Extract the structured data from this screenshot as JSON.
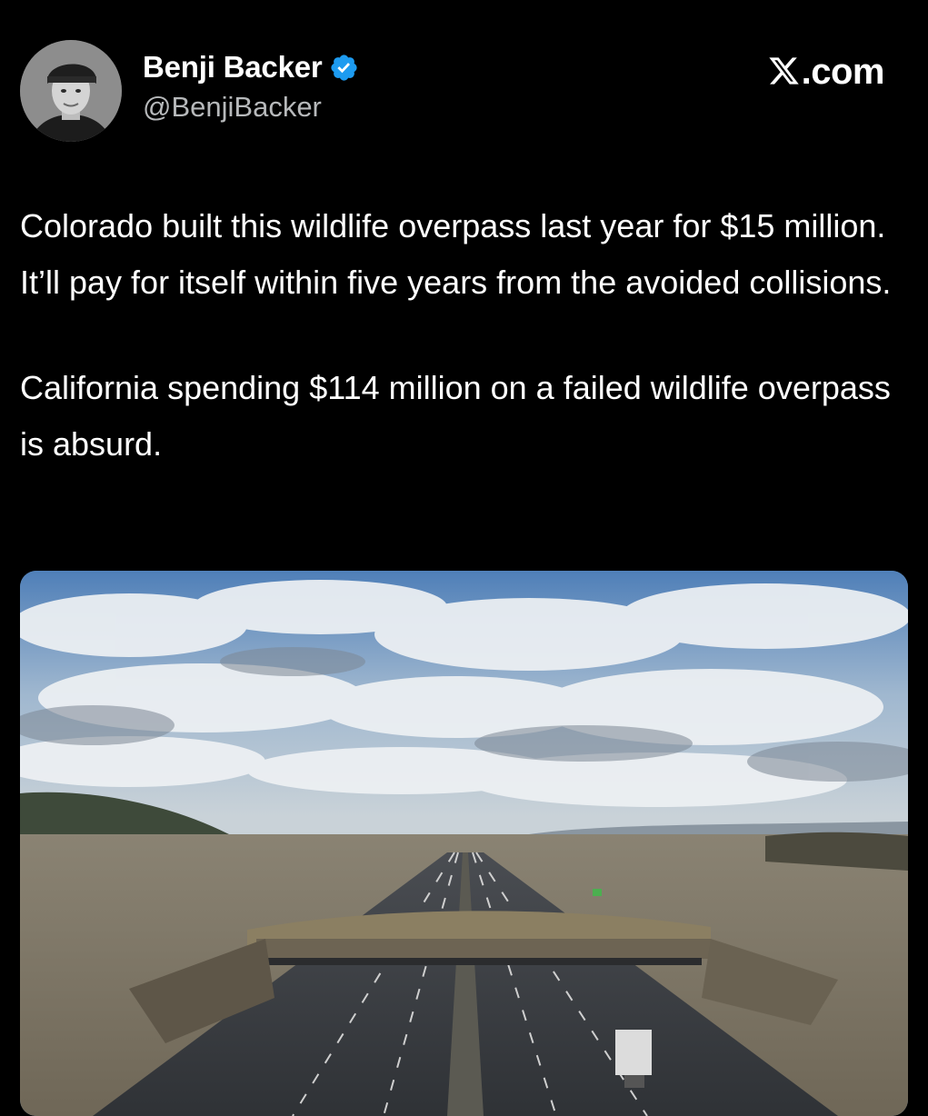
{
  "author": {
    "display_name": "Benji Backer",
    "handle": "@BenjiBacker",
    "verified": true,
    "verified_badge_color": "#1d9bf0"
  },
  "site": {
    "label": ".com",
    "logo_icon": "x-logo-icon"
  },
  "tweet": {
    "paragraphs": [
      "Colorado built this wildlife overpass last year for $15 million. It’ll pay for itself within five years from the avoided collisions.",
      "California spending $114 million on a failed wildlife overpass is absurd."
    ]
  },
  "media": {
    "kind": "photo"
  },
  "colors": {
    "background": "#000000",
    "text_primary": "#ffffff",
    "text_secondary": "#b7b9bb"
  }
}
